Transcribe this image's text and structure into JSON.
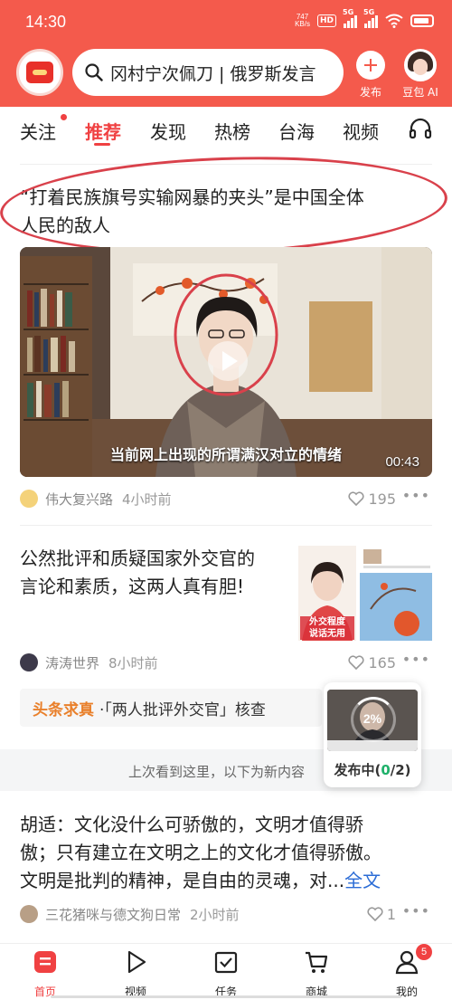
{
  "status_bar": {
    "time": "14:30",
    "net_speed_value": "747",
    "net_speed_unit": "KB/s",
    "hd": "HD",
    "sim1": "5G",
    "sim2": "5G"
  },
  "header": {
    "search_text": "冈村宁次佩刀 | 俄罗斯发言",
    "publish_label": "发布",
    "assistant_label": "豆包 AI"
  },
  "tabs": [
    "关注",
    "推荐",
    "发现",
    "热榜",
    "台海",
    "视频"
  ],
  "active_tab": "推荐",
  "feed": {
    "article1": {
      "title_line1": "“打着民族旗号实输网暴的夹头”是中国全体",
      "title_line2": "人民的敌人",
      "video_caption": "当前网上出现的所谓满汉对立的情绪",
      "duration": "00:43",
      "author": "伟大复兴路",
      "time": "4小时前",
      "likes": "195"
    },
    "article2": {
      "title_line1": "公然批评和质疑国家外交官的",
      "title_line2": "言论和素质，这两人真有胆!",
      "author": "涛涛世界",
      "time": "8小时前",
      "likes": "165",
      "fact_check_tag": "头条求真",
      "fact_check_text": "·「两人批评外交官」核查",
      "thumb_overlay_1": "外交程度",
      "thumb_overlay_2": "说话无用"
    },
    "publishing": {
      "percent": "2%",
      "label_prefix": "发布中(",
      "done": "0",
      "label_suffix": "/2)"
    },
    "last_seen": "上次看到这里，以下为新内容",
    "article3": {
      "line1": "胡适：文化没什么可骄傲的，文明才值得骄",
      "line2": "傲；只有建立在文明之上的文化才值得骄傲。",
      "line3": "文明是批判的精神，是自由的灵魂，对...",
      "full_text_link": "全文",
      "author": "三花猪咪与德文狗日常",
      "time": "2小时前",
      "likes": "1"
    }
  },
  "bottom_nav": [
    {
      "label": "首页",
      "icon": "home-icon"
    },
    {
      "label": "视频",
      "icon": "play-icon"
    },
    {
      "label": "任务",
      "icon": "task-icon"
    },
    {
      "label": "商城",
      "icon": "cart-icon"
    },
    {
      "label": "我的",
      "icon": "profile-icon"
    }
  ],
  "profile_badge": "5",
  "colors": {
    "brand_red": "#f45a4c",
    "active_tab": "#f04142",
    "annotation_circle": "#d9414b",
    "fact_check_orange": "#e9802b",
    "link_blue": "#2b6cd6",
    "progress_green": "#1fb16a"
  }
}
